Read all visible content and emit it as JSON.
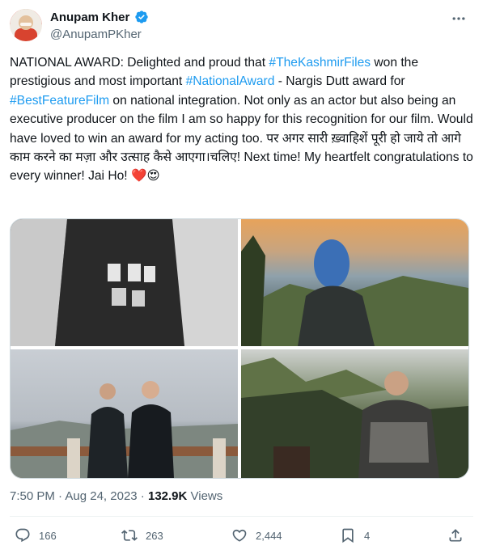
{
  "author": {
    "name": "Anupam Kher",
    "handle": "@AnupamPKher"
  },
  "tweet": {
    "t1": "NATIONAL AWARD: Delighted and proud that ",
    "h1": "#TheKashmirFiles",
    "t2": " won the prestigious and most important ",
    "h2": "#NationalAward",
    "t3": " - Nargis Dutt award for ",
    "h3": "#BestFeatureFilm",
    "t4": " on national integration. Not only as an actor but also being an executive producer on the film I am so happy for this recognition for our film. Would have loved to win an award for my acting too. पर अगर सारी ख़्वाहिशें पूरी हो जाये तो आगे काम करने का मज़ा और उत्साह कैसे आएगा।चलिए! Next time! My heartfelt congratulations to every winner! Jai Ho! ",
    "emoji_heart": "❤️",
    "emoji_face": "😍"
  },
  "meta": {
    "time": "7:50 PM",
    "sep1": " · ",
    "date": "Aug 24, 2023",
    "sep2": " · ",
    "views_count": "132.9K",
    "views_label": " Views"
  },
  "actions": {
    "replies": "166",
    "retweets": "263",
    "likes": "2,444",
    "bookmarks": "4"
  },
  "colors": {
    "accent": "#1d9bf0",
    "muted": "#536471",
    "heart": "#e0245e"
  },
  "icons": [
    "verified-badge-icon",
    "more-icon",
    "reply-icon",
    "retweet-icon",
    "like-icon",
    "bookmark-icon",
    "share-icon"
  ]
}
